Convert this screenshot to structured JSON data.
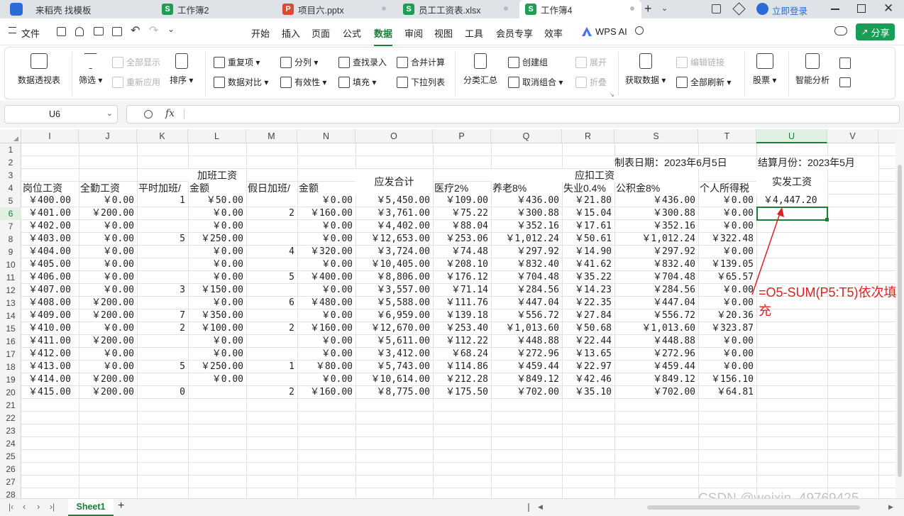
{
  "tabs": [
    {
      "label": "来稻壳 找模板",
      "icon": "docer-icon",
      "color": "#2b6bd6"
    },
    {
      "label": "工作簿2",
      "icon": "S",
      "color": "#1f9d55"
    },
    {
      "label": "项目六.pptx",
      "icon": "P",
      "color": "#d94c34"
    },
    {
      "label": "员工工资表.xlsx",
      "icon": "S",
      "color": "#1f9d55"
    },
    {
      "label": "工作簿4",
      "icon": "S",
      "color": "#1f9d55"
    }
  ],
  "login_label": "立即登录",
  "menu": {
    "file": "文件",
    "items": [
      "开始",
      "插入",
      "页面",
      "公式",
      "数据",
      "审阅",
      "视图",
      "工具",
      "会员专享",
      "效率"
    ],
    "active": "数据",
    "wps_ai": "WPS AI",
    "share": "分享"
  },
  "ribbon": {
    "pivot": "数据透视表",
    "filter": "筛选",
    "show_all": "全部显示",
    "reapply": "重新应用",
    "sort": "排序",
    "duplicates": "重复项",
    "compare": "数据对比",
    "split": "分列",
    "validity": "有效性",
    "lookup": "查找录入",
    "fill": "填充",
    "consolidate": "合并计算",
    "dropdown": "下拉列表",
    "subtotal": "分类汇总",
    "group": "创建组",
    "ungroup": "取消组合",
    "expand": "展开",
    "collapse": "折叠",
    "get_data": "获取数据",
    "edit_links": "编辑链接",
    "refresh_all": "全部刷新",
    "stocks": "股票",
    "smart": "智能分析"
  },
  "formula_bar": {
    "cell_ref": "U6",
    "fx": "fx",
    "formula": ""
  },
  "columns": [
    "I",
    "J",
    "K",
    "L",
    "M",
    "N",
    "O",
    "P",
    "Q",
    "R",
    "S",
    "T",
    "U",
    "V"
  ],
  "selected_col": "U",
  "rows": [
    "1",
    "2",
    "3",
    "4",
    "5",
    "6",
    "7",
    "8",
    "9",
    "10",
    "11",
    "12",
    "13",
    "14",
    "15",
    "16",
    "17",
    "18",
    "19",
    "20",
    "21",
    "22",
    "23",
    "24",
    "25",
    "26",
    "27",
    "28"
  ],
  "selected_row": "6",
  "header": {
    "date": "制表日期：2023年6月5日",
    "month": "结算月份：2023年5月",
    "overtime": "加班工资",
    "gross": "应发合计",
    "deduct": "应扣工资",
    "net": "实发工资",
    "I4": "岗位工资",
    "J4": "全勤工资",
    "K4": "平时加班/",
    "L4": "金额",
    "M4": "假日加班/",
    "N4": "金额",
    "P4": "医疗2%",
    "Q4": "养老8%",
    "R4": "失业0.4%",
    "S4": "公积金8%",
    "T4": "个人所得税"
  },
  "data_rows": [
    [
      "￥400.00",
      "￥0.00",
      "1",
      "￥50.00",
      "",
      "￥0.00",
      "￥5,450.00",
      "￥109.00",
      "￥436.00",
      "￥21.80",
      "￥436.00",
      "￥0.00",
      "￥4,447.20"
    ],
    [
      "￥401.00",
      "￥200.00",
      "",
      "￥0.00",
      "2",
      "￥160.00",
      "￥3,761.00",
      "￥75.22",
      "￥300.88",
      "￥15.04",
      "￥300.88",
      "￥0.00",
      ""
    ],
    [
      "￥402.00",
      "￥0.00",
      "",
      "￥0.00",
      "",
      "￥0.00",
      "￥4,402.00",
      "￥88.04",
      "￥352.16",
      "￥17.61",
      "￥352.16",
      "￥0.00",
      ""
    ],
    [
      "￥403.00",
      "￥0.00",
      "5",
      "￥250.00",
      "",
      "￥0.00",
      "￥12,653.00",
      "￥253.06",
      "￥1,012.24",
      "￥50.61",
      "￥1,012.24",
      "￥322.48",
      ""
    ],
    [
      "￥404.00",
      "￥0.00",
      "",
      "￥0.00",
      "4",
      "￥320.00",
      "￥3,724.00",
      "￥74.48",
      "￥297.92",
      "￥14.90",
      "￥297.92",
      "￥0.00",
      ""
    ],
    [
      "￥405.00",
      "￥0.00",
      "",
      "￥0.00",
      "",
      "￥0.00",
      "￥10,405.00",
      "￥208.10",
      "￥832.40",
      "￥41.62",
      "￥832.40",
      "￥139.05",
      ""
    ],
    [
      "￥406.00",
      "￥0.00",
      "",
      "￥0.00",
      "5",
      "￥400.00",
      "￥8,806.00",
      "￥176.12",
      "￥704.48",
      "￥35.22",
      "￥704.48",
      "￥65.57",
      ""
    ],
    [
      "￥407.00",
      "￥0.00",
      "3",
      "￥150.00",
      "",
      "￥0.00",
      "￥3,557.00",
      "￥71.14",
      "￥284.56",
      "￥14.23",
      "￥284.56",
      "￥0.00",
      ""
    ],
    [
      "￥408.00",
      "￥200.00",
      "",
      "￥0.00",
      "6",
      "￥480.00",
      "￥5,588.00",
      "￥111.76",
      "￥447.04",
      "￥22.35",
      "￥447.04",
      "￥0.00",
      ""
    ],
    [
      "￥409.00",
      "￥200.00",
      "7",
      "￥350.00",
      "",
      "￥0.00",
      "￥6,959.00",
      "￥139.18",
      "￥556.72",
      "￥27.84",
      "￥556.72",
      "￥20.36",
      ""
    ],
    [
      "￥410.00",
      "￥0.00",
      "2",
      "￥100.00",
      "2",
      "￥160.00",
      "￥12,670.00",
      "￥253.40",
      "￥1,013.60",
      "￥50.68",
      "￥1,013.60",
      "￥323.87",
      ""
    ],
    [
      "￥411.00",
      "￥200.00",
      "",
      "￥0.00",
      "",
      "￥0.00",
      "￥5,611.00",
      "￥112.22",
      "￥448.88",
      "￥22.44",
      "￥448.88",
      "￥0.00",
      ""
    ],
    [
      "￥412.00",
      "￥0.00",
      "",
      "￥0.00",
      "",
      "￥0.00",
      "￥3,412.00",
      "￥68.24",
      "￥272.96",
      "￥13.65",
      "￥272.96",
      "￥0.00",
      ""
    ],
    [
      "￥413.00",
      "￥0.00",
      "5",
      "￥250.00",
      "1",
      "￥80.00",
      "￥5,743.00",
      "￥114.86",
      "￥459.44",
      "￥22.97",
      "￥459.44",
      "￥0.00",
      ""
    ],
    [
      "￥414.00",
      "￥200.00",
      "",
      "￥0.00",
      "",
      "￥0.00",
      "￥10,614.00",
      "￥212.28",
      "￥849.12",
      "￥42.46",
      "￥849.12",
      "￥156.10",
      ""
    ],
    [
      "￥415.00",
      "￥200.00",
      "0",
      "",
      "2",
      "￥160.00",
      "￥8,775.00",
      "￥175.50",
      "￥702.00",
      "￥35.10",
      "￥702.00",
      "￥64.81",
      ""
    ]
  ],
  "annotation": "=O5-SUM(P5:T5)依次填充",
  "sheet_tab": "Sheet1",
  "watermark": "CSDN @weixin_49769425",
  "colors": {
    "accent": "#1a7f37",
    "annotation": "#e02020"
  }
}
